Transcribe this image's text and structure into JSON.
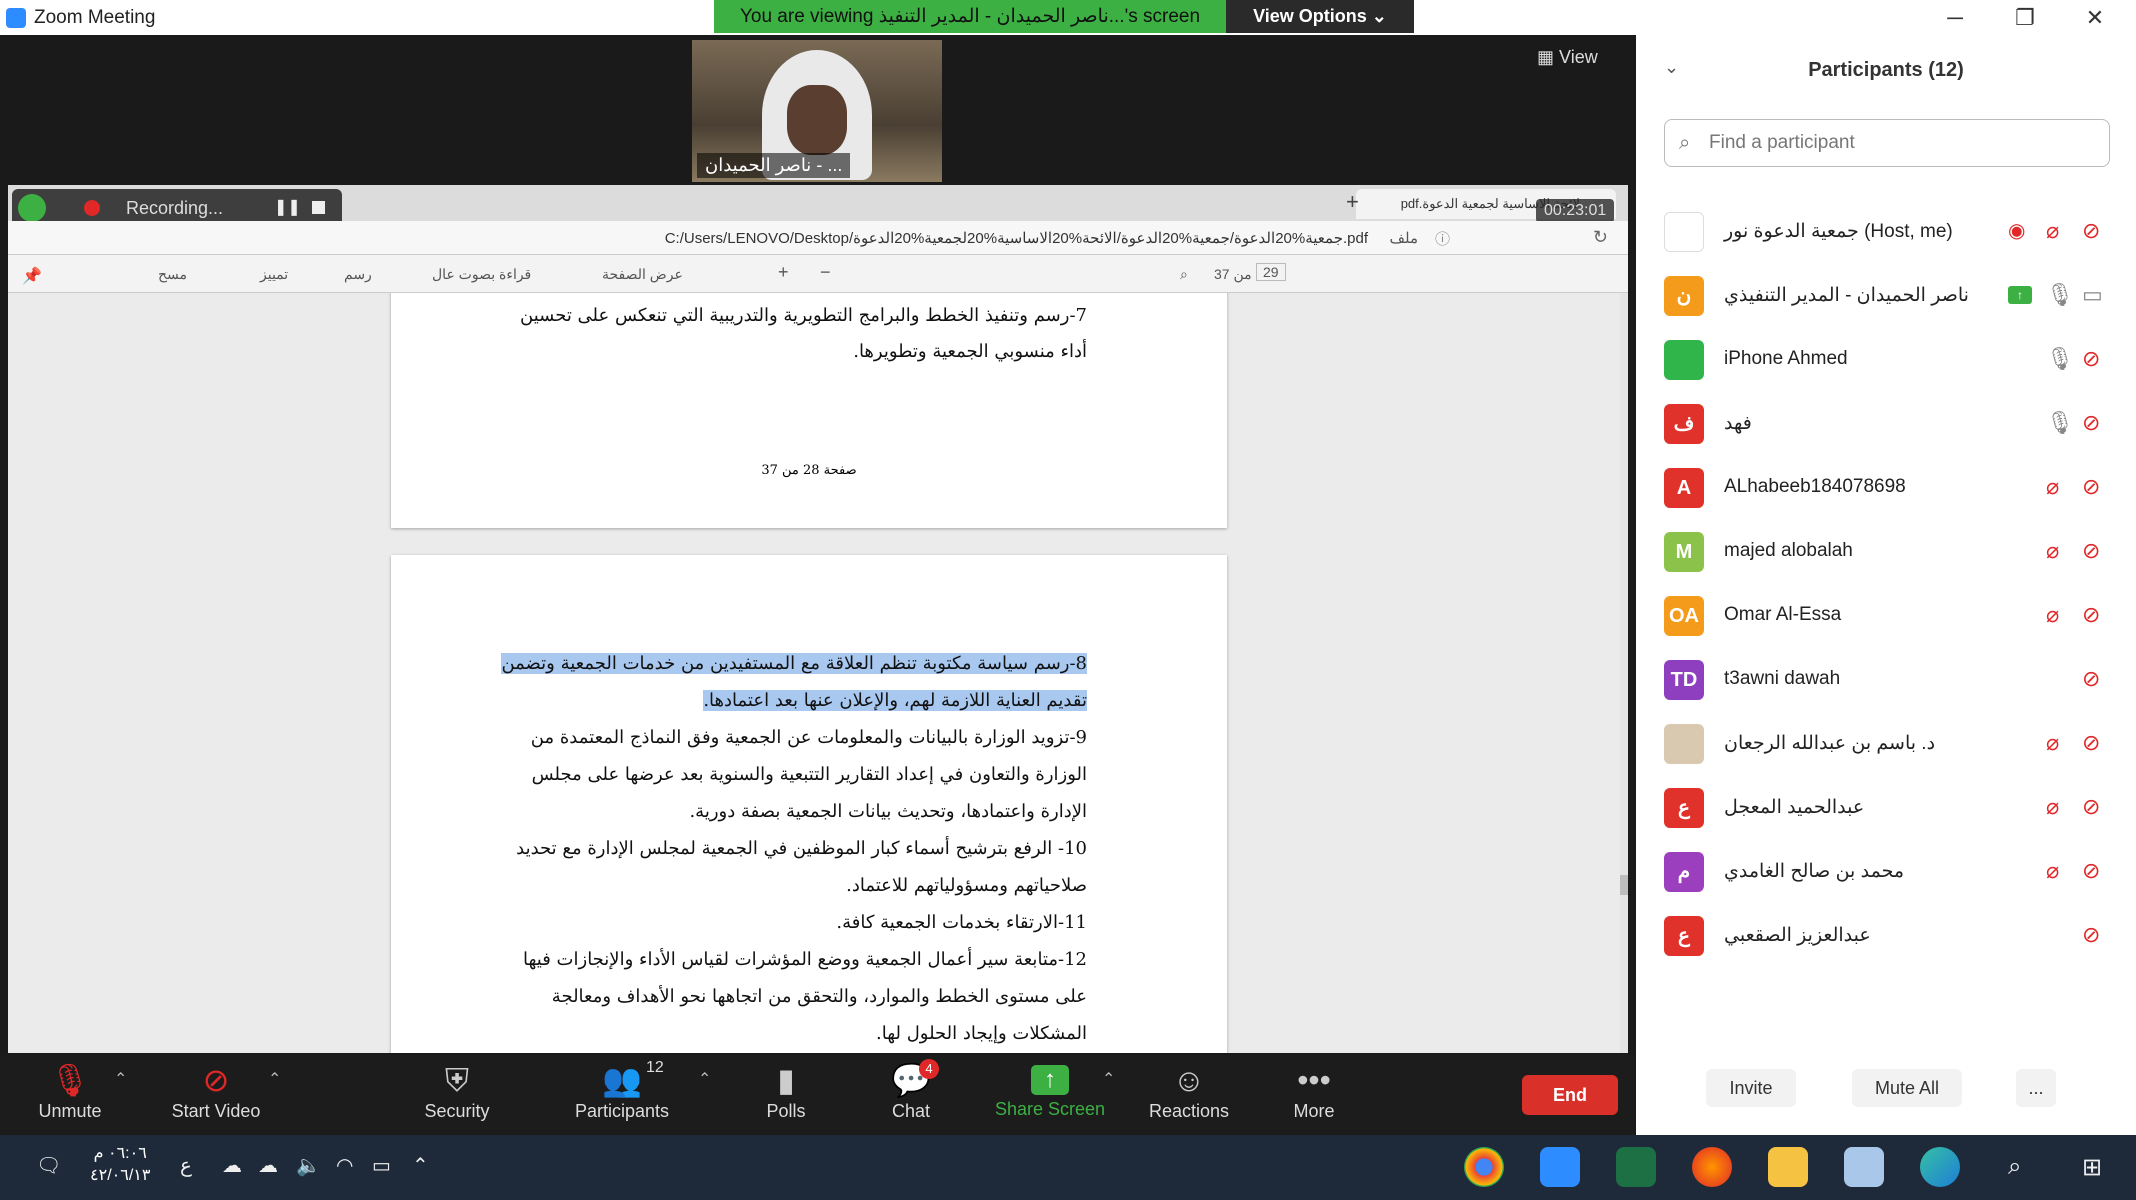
{
  "window": {
    "title": "Zoom Meeting",
    "controls": {
      "minimize": "─",
      "maximize": "❐",
      "close": "✕"
    }
  },
  "banner": {
    "viewing_text": "You are viewing ناصر الحميدان - المدير التنفيذ...'s screen",
    "view_options": "View Options ⌄"
  },
  "video": {
    "speaker_name": "ناصر الحميدان - ...",
    "view_label": "View"
  },
  "shared_screen": {
    "recording_label": "Recording...",
    "timer": "00:23:01",
    "tab_title": "لائحة الاساسية لجمعية الدعوة.pdf",
    "path": "C:/Users/LENOVO/Desktop/جمعية%20الدعوة/جمعية%20الدعوة/الائحة%20الاساسية%20لجمعية%20الدعوة.pdf",
    "file_label": "ملف",
    "toolbar": {
      "page_current": "29",
      "page_of": "من 37",
      "page_view": "عرض الصفحة",
      "read_aloud": "قراءة بصوت عال",
      "draw": "رسم",
      "highlight": "تمييز",
      "erase": "مسح"
    },
    "page1_lines": [
      "7-رسم وتنفيذ الخطط والبرامج التطويرية والتدريبية التي تنعكس على تحسين",
      "أداء منسوبي الجمعية وتطويرها."
    ],
    "page1_footer": "صفحة 28 من 37",
    "page2_lines": [
      "8-رسم سياسة مكتوبة تنظم العلاقة مع المستفيدين من خدمات الجمعية وتضمن",
      "تقديم العناية اللازمة لهم، والإعلان عنها بعد اعتمادها.",
      "9-تزويد الوزارة بالبيانات والمعلومات عن الجمعية وفق النماذج المعتمدة من",
      "الوزارة والتعاون في إعداد التقارير التتبعية والسنوية بعد عرضها على مجلس",
      "الإدارة واعتمادها، وتحديث بيانات الجمعية بصفة دورية.",
      "10- الرفع بترشيح أسماء كبار الموظفين في الجمعية لمجلس الإدارة مع تحديد",
      "صلاحياتهم ومسؤولياتهم للاعتماد.",
      "11-الارتقاء بخدمات الجمعية كافة.",
      "12-متابعة سير أعمال الجمعية ووضع المؤشرات لقياس الأداء والإنجازات فيها",
      "على مستوى الخطط والموارد، والتحقق من اتجاهها نحو الأهداف ومعالجة",
      "المشكلات وإيجاد الحلول لها."
    ]
  },
  "controls": {
    "unmute": "Unmute",
    "start_video": "Start Video",
    "security": "Security",
    "participants": "Participants",
    "participants_count": "12",
    "polls": "Polls",
    "chat": "Chat",
    "chat_badge": "4",
    "share_screen": "Share Screen",
    "reactions": "Reactions",
    "more": "More",
    "end": "End"
  },
  "panel": {
    "title": "Participants (12)",
    "search_placeholder": "Find a participant",
    "participants": [
      {
        "name": "جمعية الدعوة نور (Host, me)",
        "initials": "",
        "color": "#ffffff",
        "mic": "muted",
        "cam": "off",
        "recording": true
      },
      {
        "name": "ناصر الحميدان - المدير التنفيذي",
        "initials": "ن",
        "color": "#f59b1b",
        "mic": "on",
        "cam": "on",
        "sharing": true
      },
      {
        "name": "iPhone Ahmed",
        "initials": "",
        "color": "#2fb54a",
        "mic": "on",
        "cam": "off"
      },
      {
        "name": "فهد",
        "initials": "ف",
        "color": "#e0322b",
        "mic": "on",
        "cam": "off"
      },
      {
        "name": "ALhabeeb184078698",
        "initials": "A",
        "color": "#e0322b",
        "mic": "muted",
        "cam": "off"
      },
      {
        "name": "majed alobalah",
        "initials": "M",
        "color": "#8bc34a",
        "mic": "muted",
        "cam": "off"
      },
      {
        "name": "Omar Al-Essa",
        "initials": "OA",
        "color": "#f59b1b",
        "mic": "muted",
        "cam": "off"
      },
      {
        "name": "t3awni dawah",
        "initials": "TD",
        "color": "#8e3fbf",
        "mic": "none",
        "cam": "muted"
      },
      {
        "name": "د. باسم بن عبدالله الرجعان",
        "initials": "",
        "color": "#d8c9b0",
        "mic": "muted",
        "cam": "off"
      },
      {
        "name": "عبدالحميد المعجل",
        "initials": "ع",
        "color": "#e0322b",
        "mic": "muted",
        "cam": "off"
      },
      {
        "name": "محمد بن صالح الغامدي",
        "initials": "م",
        "color": "#9b3fbf",
        "mic": "muted",
        "cam": "off"
      },
      {
        "name": "عبدالعزيز الصقعبي",
        "initials": "ع",
        "color": "#e0322b",
        "mic": "none",
        "cam": "off"
      }
    ],
    "invite": "Invite",
    "mute_all": "Mute All",
    "more": "..."
  },
  "taskbar": {
    "time": "٠٦:٠٦ م",
    "date": "٤٢/٠٦/١٣",
    "lang": "ع"
  }
}
